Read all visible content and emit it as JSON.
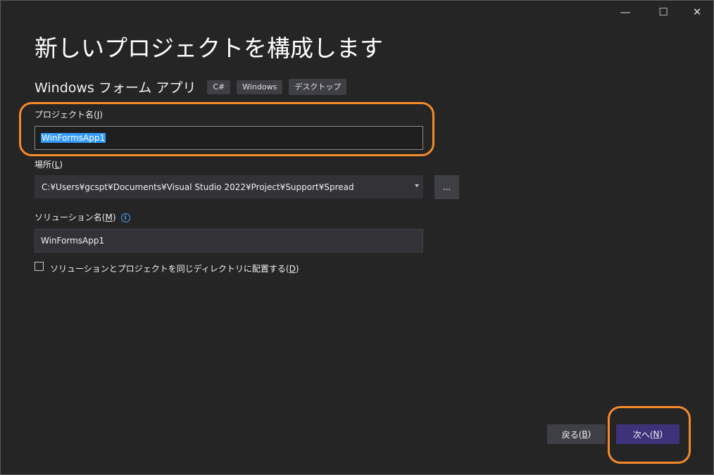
{
  "window": {
    "minimize_glyph": "—",
    "maximize_glyph": "☐",
    "close_glyph": "✕"
  },
  "page": {
    "title": "新しいプロジェクトを構成します",
    "template_name": "Windows フォーム アプリ",
    "tags": [
      "C#",
      "Windows",
      "デスクトップ"
    ]
  },
  "project_name": {
    "label": "プロジェクト名(J)",
    "label_main": "プロジェクト名(",
    "label_key": "J",
    "label_end": ")",
    "value": "WinFormsApp1"
  },
  "location": {
    "label_main": "場所(",
    "label_key": "L",
    "label_end": ")",
    "value": "C:¥Users¥gcspt¥Documents¥Visual Studio 2022¥Project¥Support¥Spread",
    "browse_label": "..."
  },
  "solution_name": {
    "label_main": "ソリューション名(",
    "label_key": "M",
    "label_end": ")",
    "info_icon": "info-icon",
    "value": "WinFormsApp1"
  },
  "same_directory": {
    "label_main": "ソリューションとプロジェクトを同じディレクトリに配置する(",
    "label_key": "D",
    "label_end": ")",
    "checked": false
  },
  "buttons": {
    "back_main": "戻る(",
    "back_key": "B",
    "back_end": ")",
    "next_main": "次へ(",
    "next_key": "N",
    "next_end": ")"
  },
  "colors": {
    "background": "#252526",
    "primary_button": "#3e327b",
    "highlight_annotation": "#f58a2a",
    "selection": "#3399ff"
  }
}
